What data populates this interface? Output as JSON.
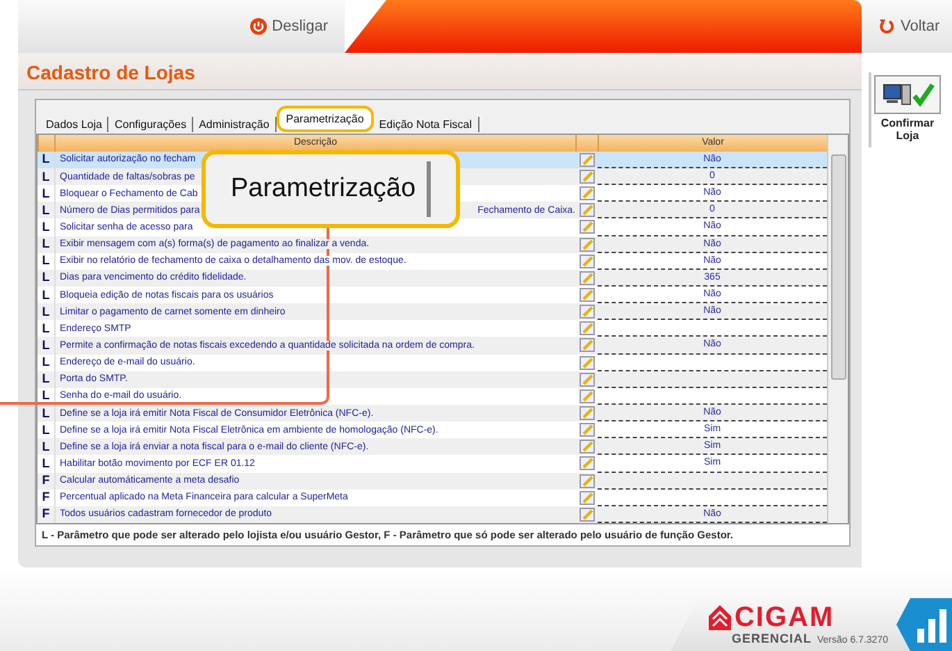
{
  "top_bar": {
    "power_button": "Desligar",
    "back_button": "Voltar"
  },
  "title": "Cadastro de Lojas",
  "tabs": [
    {
      "label": "Dados Loja",
      "selected": false
    },
    {
      "label": "Configurações",
      "selected": false
    },
    {
      "label": "Administração",
      "selected": false
    },
    {
      "label": "Parametrização",
      "selected": true
    },
    {
      "label": "Edição Nota Fiscal",
      "selected": false
    }
  ],
  "table": {
    "columns": [
      "Descrição",
      "Valor"
    ],
    "rows": [
      {
        "type": "L",
        "description": "Solicitar autorização no fecham",
        "value": "Não",
        "selected": true
      },
      {
        "type": "L",
        "description": "Quantidade de faltas/sobras pe",
        "value": "0",
        "selected": false
      },
      {
        "type": "L",
        "description": "Bloquear o Fechamento de Cab",
        "value": "Não",
        "selected": false
      },
      {
        "type": "L",
        "description": "Número de Dias permitidos para",
        "description_end": "Fechamento de Caixa.",
        "value": "0",
        "selected": false
      },
      {
        "type": "L",
        "description": "Solicitar senha de acesso para",
        "value": "Não",
        "selected": false
      },
      {
        "type": "L",
        "description": "Exibir mensagem com a(s) forma(s) de pagamento ao finalizar a venda.",
        "value": "Não",
        "selected": false
      },
      {
        "type": "L",
        "description": "Exibir no relatório de fechamento de caixa o detalhamento das mov. de estoque.",
        "value": "Não",
        "selected": false
      },
      {
        "type": "L",
        "description": "Dias para vencimento do crédito fidelidade.",
        "value": "365",
        "selected": false
      },
      {
        "type": "L",
        "description": "Bloqueia edição de notas fiscais para os usuários",
        "value": "Não",
        "selected": false
      },
      {
        "type": "L",
        "description": "Limitar o pagamento de carnet somente em dinheiro",
        "value": "Não",
        "selected": false
      },
      {
        "type": "L",
        "description": "Endereço SMTP",
        "selected": false
      },
      {
        "type": "L",
        "description": "Permite a confirmação de notas fiscais excedendo a quantidade solicitada na ordem de compra.",
        "value": "Não",
        "selected": false
      },
      {
        "type": "L",
        "description": "Endereço de e-mail do usuário.",
        "selected": false
      },
      {
        "type": "L",
        "description": "Porta do SMTP.",
        "selected": false
      },
      {
        "type": "L",
        "description": "Senha do e-mail do usuário.",
        "selected": false
      },
      {
        "type": "L",
        "description": "Define se a loja irá emitir Nota Fiscal de Consumidor Eletrônica (NFC-e).",
        "value": "Não",
        "selected": false
      },
      {
        "type": "L",
        "description": "Define se a loja irá emitir Nota Fiscal  Eletrônica em ambiente de homologação (NFC-e).",
        "value": "Sim",
        "selected": false
      },
      {
        "type": "L",
        "description": "Define se a loja irá enviar a nota fiscal para o e-mail do cliente (NFC-e).",
        "value": "Sim",
        "selected": false
      },
      {
        "type": "L",
        "description": "Habilitar botão movimento por ECF ER 01.12",
        "value": "Sim",
        "selected": false
      },
      {
        "type": "F",
        "description": "Calcular automáticamente a meta desafio",
        "selected": false
      },
      {
        "type": "F",
        "description": "Percentual aplicado na Meta Financeira para calcular a SuperMeta",
        "selected": false
      },
      {
        "type": "F",
        "description": "Todos usuários cadastram fornecedor de produto",
        "value": "Não",
        "selected": false
      }
    ]
  },
  "legend": "L - Parâmetro que pode ser alterado pelo lojista e/ou usuário Gestor,   F - Parâmetro que só pode ser alterado pelo usuário de função Gestor.",
  "callout": {
    "text": "Parametrização"
  },
  "side_panel": {
    "confirm_button": "Confirmar Loja"
  },
  "footer": {
    "logo": "CIGAM",
    "edition": "GERENCIAL",
    "version": "Versão 6.7.3270"
  }
}
